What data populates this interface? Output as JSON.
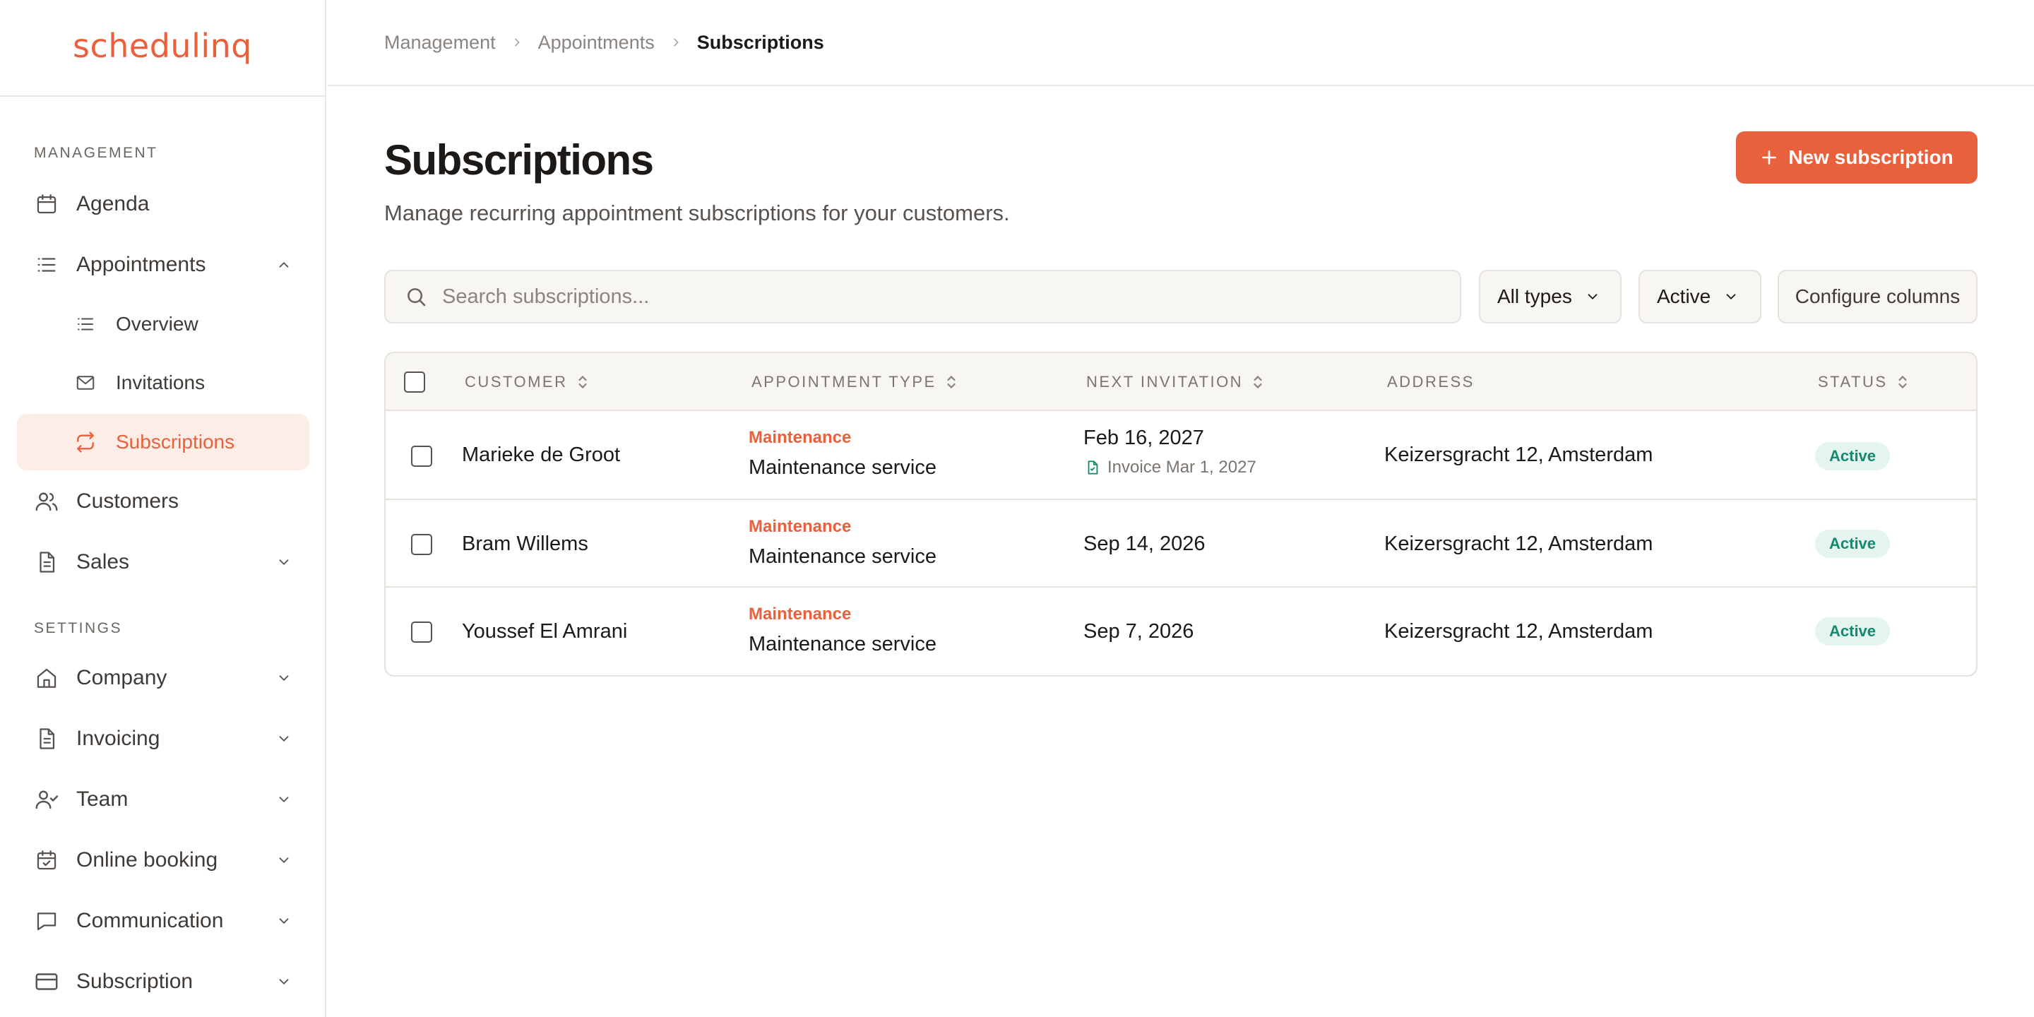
{
  "app": {
    "logo_text": "schedulinq"
  },
  "sidebar": {
    "sections": {
      "management": "MANAGEMENT",
      "settings": "SETTINGS"
    },
    "items": [
      {
        "label": "Agenda",
        "icon": "calendar-icon"
      },
      {
        "label": "Appointments",
        "icon": "list-icon",
        "expanded": true
      },
      {
        "label": "Overview",
        "icon": "list-icon",
        "sub": true
      },
      {
        "label": "Invitations",
        "icon": "mail-icon",
        "sub": true
      },
      {
        "label": "Subscriptions",
        "icon": "repeat-icon",
        "sub": true,
        "active": true
      },
      {
        "label": "Customers",
        "icon": "users-icon"
      },
      {
        "label": "Sales",
        "icon": "document-icon"
      },
      {
        "label": "Company",
        "icon": "home-icon"
      },
      {
        "label": "Invoicing",
        "icon": "document-icon"
      },
      {
        "label": "Team",
        "icon": "user-check-icon"
      },
      {
        "label": "Online booking",
        "icon": "calendar-check-icon"
      },
      {
        "label": "Communication",
        "icon": "chat-icon"
      },
      {
        "label": "Subscription",
        "icon": "credit-card-icon"
      }
    ]
  },
  "breadcrumb": [
    "Management",
    "Appointments",
    "Subscriptions"
  ],
  "page": {
    "title": "Subscriptions",
    "subtitle": "Manage recurring appointment subscriptions for your customers.",
    "new_button": "New subscription"
  },
  "filters": {
    "search_placeholder": "Search subscriptions...",
    "type_filter": "All types",
    "status_filter": "Active",
    "configure_columns": "Configure columns"
  },
  "table": {
    "columns": [
      "CUSTOMER",
      "APPOINTMENT TYPE",
      "NEXT INVITATION",
      "ADDRESS",
      "STATUS"
    ],
    "rows": [
      {
        "customer": "Marieke de Groot",
        "type_category": "Maintenance",
        "type_name": "Maintenance service",
        "next_invitation": "Feb 16, 2027",
        "invoice": "Invoice Mar 1, 2027",
        "address": "Keizersgracht 12, Amsterdam",
        "status": "Active"
      },
      {
        "customer": "Bram Willems",
        "type_category": "Maintenance",
        "type_name": "Maintenance service",
        "next_invitation": "Sep 14, 2026",
        "address": "Keizersgracht 12, Amsterdam",
        "status": "Active"
      },
      {
        "customer": "Youssef El Amrani",
        "type_category": "Maintenance",
        "type_name": "Maintenance service",
        "next_invitation": "Sep 7, 2026",
        "address": "Keizersgracht 12, Amsterdam",
        "status": "Active"
      }
    ]
  },
  "colors": {
    "accent": "#e8603c",
    "accent_soft": "#fdede7",
    "status_active_bg": "#e4f4ef",
    "status_active_text": "#148a6e",
    "border": "#e7e1db"
  }
}
